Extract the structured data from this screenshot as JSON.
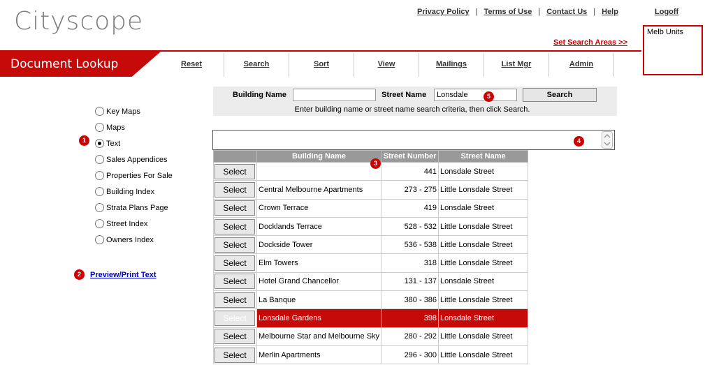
{
  "header": {
    "logo": "Cityscope",
    "links": [
      "Privacy Policy",
      "Terms of Use",
      "Contact Us",
      "Help"
    ],
    "logoff": "Logoff",
    "set_search_areas": "Set Search Areas >>",
    "units": "Melb Units"
  },
  "title": "Document Lookup",
  "nav": [
    "Reset",
    "Search",
    "Sort",
    "View",
    "Mailings",
    "List Mgr",
    "Admin"
  ],
  "radios": [
    {
      "label": "Key Maps",
      "checked": false
    },
    {
      "label": "Maps",
      "checked": false
    },
    {
      "label": "Text",
      "checked": true
    },
    {
      "label": "Sales Appendices",
      "checked": false
    },
    {
      "label": "Properties For Sale",
      "checked": false
    },
    {
      "label": "Building Index",
      "checked": false
    },
    {
      "label": "Strata Plans Page",
      "checked": false
    },
    {
      "label": "Street Index",
      "checked": false
    },
    {
      "label": "Owners Index",
      "checked": false
    }
  ],
  "preview_link": "Preview/Print Text",
  "search": {
    "building_label": "Building Name",
    "building_value": "",
    "street_label": "Street Name",
    "street_value": "Lonsdale",
    "button": "Search",
    "hint": "Enter building name or street name search criteria, then click Search."
  },
  "markers": [
    "1",
    "2",
    "3",
    "4",
    "5"
  ],
  "table": {
    "headers": [
      "",
      "Building Name",
      "Street Number",
      "Street Name"
    ],
    "select_label": "Select",
    "rows": [
      {
        "building": "",
        "number": "441",
        "street": "Lonsdale Street"
      },
      {
        "building": "Central Melbourne Apartments",
        "number": "273 - 275",
        "street": "Little Lonsdale Street"
      },
      {
        "building": "Crown Terrace",
        "number": "419",
        "street": "Lonsdale Street"
      },
      {
        "building": "Docklands Terrace",
        "number": "528 - 532",
        "street": "Little Lonsdale Street"
      },
      {
        "building": "Dockside Tower",
        "number": "536 - 538",
        "street": "Little Lonsdale Street"
      },
      {
        "building": "Elm Towers",
        "number": "318",
        "street": "Little Lonsdale Street"
      },
      {
        "building": "Hotel Grand Chancellor",
        "number": "131 - 137",
        "street": "Lonsdale Street"
      },
      {
        "building": "La Banque",
        "number": "380 - 386",
        "street": "Little Lonsdale Street"
      },
      {
        "building": "Lonsdale Gardens",
        "number": "398",
        "street": "Lonsdale Street",
        "highlight": true
      },
      {
        "building": "Melbourne Star and Melbourne Sky",
        "number": "280 - 292",
        "street": "Little Lonsdale Street"
      },
      {
        "building": "Merlin Apartments",
        "number": "296 - 300",
        "street": "Little Lonsdale Street"
      }
    ]
  },
  "colors": {
    "accent": "#c60a0a",
    "header_gray": "#999999"
  }
}
